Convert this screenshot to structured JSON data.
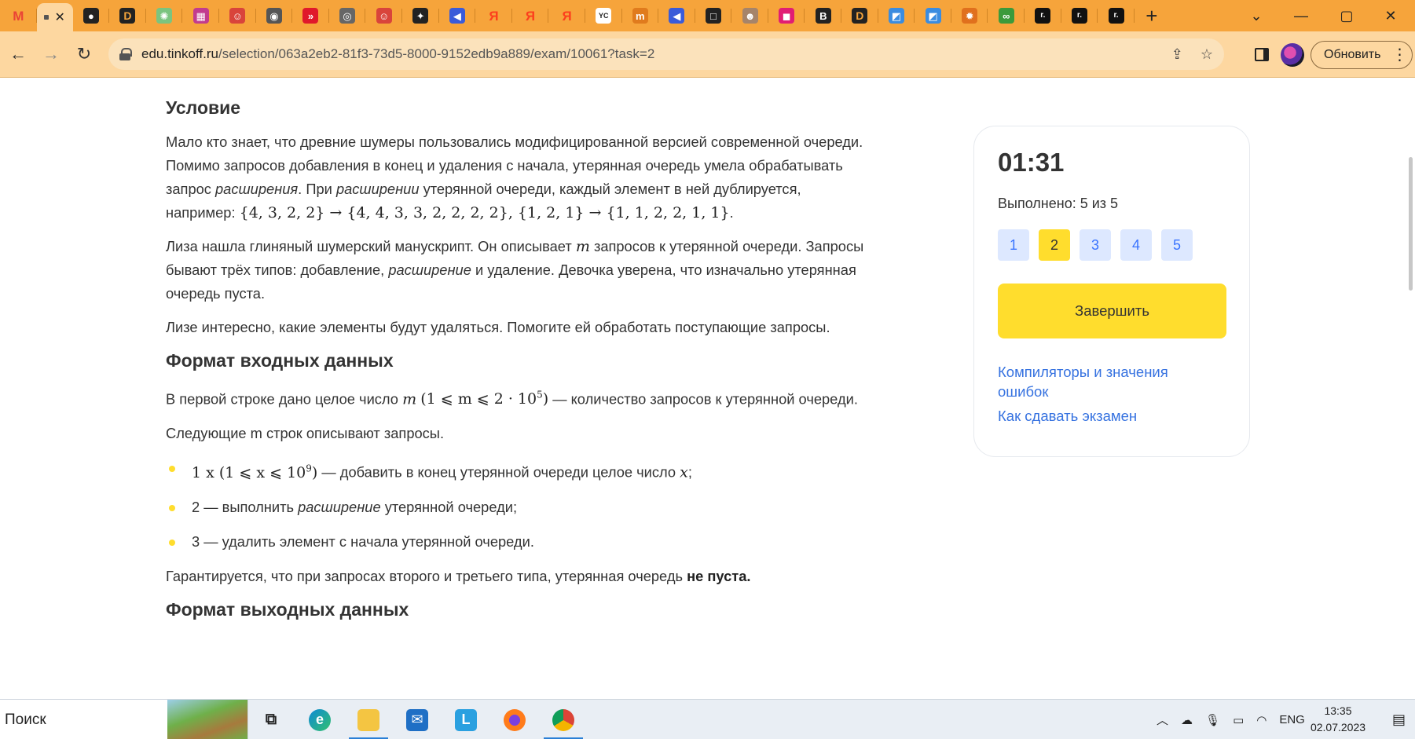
{
  "browser": {
    "tab_icons": [
      {
        "icon": "gmail-icon",
        "color": "#ea4335",
        "glyph": "M"
      },
      {
        "icon": "bravo-icon",
        "color": "#222222",
        "glyph": "●"
      },
      {
        "icon": "d-letter-icon",
        "color": "#f6a43b",
        "glyph": "D"
      },
      {
        "icon": "green-dots-icon",
        "color": "#7bc47f",
        "glyph": "✺"
      },
      {
        "icon": "pattern-icon",
        "color": "#c23b8f",
        "glyph": "▦"
      },
      {
        "icon": "mascot-icon",
        "color": "#d9443b",
        "glyph": "☺"
      },
      {
        "icon": "globe-icon",
        "color": "#555555",
        "glyph": "◉"
      },
      {
        "icon": "arrows-icon",
        "color": "#e0182b",
        "glyph": "»"
      },
      {
        "icon": "chrome-icon",
        "color": "#666666",
        "glyph": "◎"
      },
      {
        "icon": "mascot-icon",
        "color": "#d9443b",
        "glyph": "☺"
      },
      {
        "icon": "bee-icon",
        "color": "#222222",
        "glyph": "✦"
      },
      {
        "icon": "flag-icon",
        "color": "#3a5bd9",
        "glyph": "◀"
      },
      {
        "icon": "yandex-icon",
        "color": "#fc3f1d",
        "glyph": "Я"
      },
      {
        "icon": "yandex-icon",
        "color": "#fc3f1d",
        "glyph": "Я"
      },
      {
        "icon": "yandex-icon",
        "color": "#fc3f1d",
        "glyph": "Я"
      },
      {
        "icon": "yc-icon",
        "color": "#ffffff",
        "glyph": "YC"
      },
      {
        "icon": "tech-icon",
        "color": "#e07b1d",
        "glyph": "m"
      },
      {
        "icon": "flag-icon",
        "color": "#3a5bd9",
        "glyph": "◀"
      },
      {
        "icon": "square-icon",
        "color": "#222222",
        "glyph": "□"
      },
      {
        "icon": "avatar-icon",
        "color": "#a6846a",
        "glyph": "☻"
      },
      {
        "icon": "pink-icon",
        "color": "#e11d74",
        "glyph": "◼"
      },
      {
        "icon": "b-icon",
        "color": "#222222",
        "glyph": "B"
      },
      {
        "icon": "d-letter-icon",
        "color": "#f6a43b",
        "glyph": "D"
      },
      {
        "icon": "image-icon",
        "color": "#3a8ce0",
        "glyph": "◩"
      },
      {
        "icon": "image-icon",
        "color": "#3a8ce0",
        "glyph": "◩"
      },
      {
        "icon": "sun-icon",
        "color": "#e0701d",
        "glyph": "✹"
      },
      {
        "icon": "infinity-icon",
        "color": "#3b9a3b",
        "glyph": "∞"
      },
      {
        "icon": "r-icon",
        "color": "#111111",
        "glyph": "r."
      },
      {
        "icon": "r-icon",
        "color": "#111111",
        "glyph": "r."
      },
      {
        "icon": "r-icon",
        "color": "#111111",
        "glyph": "r."
      }
    ],
    "url_host": "edu.tinkoff.ru",
    "url_path": "/selection/063a2eb2-81f3-73d5-8000-9152edb9a889/exam/10061?task=2",
    "update_label": "Обновить"
  },
  "article": {
    "heading_condition": "Условие",
    "p1_a": "Мало кто знает, что древние шумеры пользовались модифицированной версией современной очереди. Помимо запросов добавления в конец и удаления с начала, утерянная очередь умела обрабатывать запрос ",
    "p1_em1": "расширения",
    "p1_b": ". При ",
    "p1_em2": "расширении",
    "p1_c": " утерянной очереди, каждый элемент в ней дублируется, например: ",
    "p1_math": "{4, 3, 2, 2} → {4, 4, 3, 3, 2, 2, 2, 2}, {1, 2, 1} → {1, 1, 2, 2, 1, 1}",
    "p1_end": ".",
    "p2_a": "Лиза нашла глиняный шумерский манускрипт. Он описывает ",
    "p2_m": "m",
    "p2_b": " запросов к утерянной очереди. Запросы бывают трёх типов: добавление, ",
    "p2_em": "расширение",
    "p2_c": " и удаление. Девочка уверена, что изначально утерянная очередь пуста.",
    "p3": "Лизе интересно, какие элементы будут удаляться. Помогите ей обработать поступающие запросы.",
    "heading_input": "Формат входных данных",
    "p4_a": "В первой строке дано целое число ",
    "p4_m": "m",
    "p4_cond": "(1 ⩽ m ⩽ 2 · 10",
    "p4_exp": "5",
    "p4_close": ")",
    "p4_b": " — количество запросов к утерянной очереди.",
    "p5": "Следующие m строк описывают запросы.",
    "li1_math": "1 x (1 ⩽ x ⩽ 10",
    "li1_exp": "9",
    "li1_close": ")",
    "li1_text": " — добавить в конец утерянной очереди целое число ",
    "li1_x": "x",
    "li1_end": ";",
    "li2_a": "2 — выполнить ",
    "li2_em": "расширение",
    "li2_b": " утерянной очереди;",
    "li3": "3 — удалить элемент с начала утерянной очереди.",
    "p6_a": "Гарантируется, что при запросах второго и третьего типа, утерянная очередь ",
    "p6_b": "не пуста.",
    "heading_output": "Формат выходных данных"
  },
  "side": {
    "timer": "01:31",
    "done": "Выполнено: 5 из 5",
    "tasks": [
      "1",
      "2",
      "3",
      "4",
      "5"
    ],
    "current_task": "2",
    "finish": "Завершить",
    "link_compilers": "Компиляторы и значения ошибок",
    "link_howto": "Как сдавать экзамен"
  },
  "taskbar": {
    "search": "Поиск",
    "lang": "ENG",
    "time": "13:35",
    "date": "02.07.2023"
  },
  "colors": {
    "tab_strip": "#f6a43b",
    "toolbar": "#fdd7a0",
    "accent_yellow": "#ffdd2d",
    "task_chip": "#dde8ff",
    "link": "#3672e0"
  }
}
